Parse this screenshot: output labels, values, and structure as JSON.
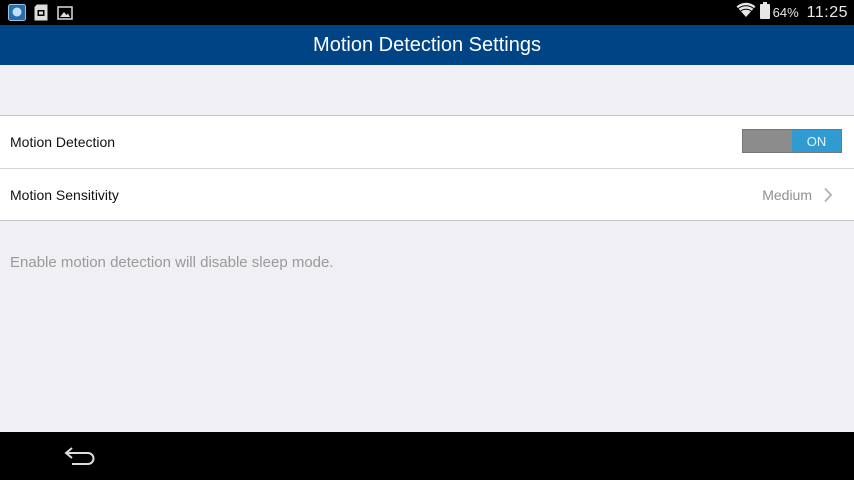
{
  "status_bar": {
    "left_icons": [
      "app-notification-icon",
      "sd-card-icon",
      "image-icon"
    ],
    "wifi_icon": "wifi-icon",
    "battery_icon": "battery-icon",
    "battery": "64%",
    "time": "11:25"
  },
  "header": {
    "title": "Motion Detection Settings",
    "background": "#004486"
  },
  "settings": {
    "motion_detection": {
      "label": "Motion Detection",
      "toggle_text": "ON",
      "enabled": true,
      "accent": "#2f9bd2"
    },
    "motion_sensitivity": {
      "label": "Motion Sensitivity",
      "value": "Medium",
      "icon": "chevron-right-icon"
    }
  },
  "note": "Enable motion detection will disable sleep mode.",
  "nav_bar": {
    "back_icon": "back-arrow-icon"
  }
}
